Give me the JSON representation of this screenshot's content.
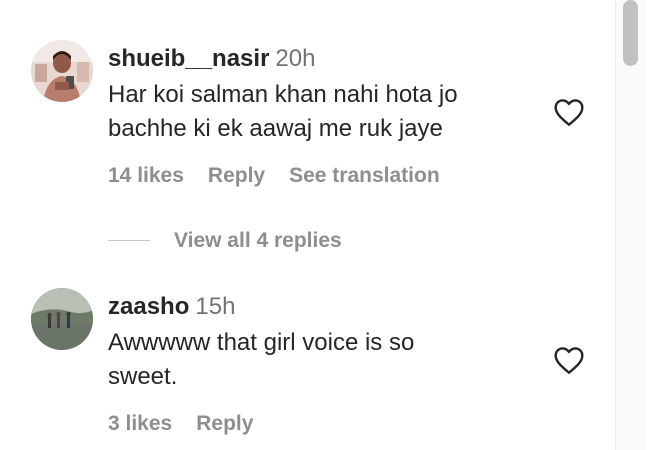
{
  "comments": [
    {
      "username": "shueib__nasir",
      "time": "20h",
      "text_line1": "Har koi salman khan nahi hota jo",
      "text_line2": "bachhe ki ek aawaj me ruk jaye",
      "likes": "14 likes",
      "reply": "Reply",
      "translate": "See translation",
      "view_replies": "View all 4 replies",
      "like_icon": "heart-outline-icon"
    },
    {
      "username": "zaasho",
      "time": "15h",
      "text_line1": "Awwwww that girl voice is so",
      "text_line2": "sweet.",
      "likes": "3 likes",
      "reply": "Reply",
      "like_icon": "heart-outline-icon"
    }
  ],
  "colors": {
    "text": "#262626",
    "muted": "#8e8e8e",
    "timestamp": "#737373"
  }
}
